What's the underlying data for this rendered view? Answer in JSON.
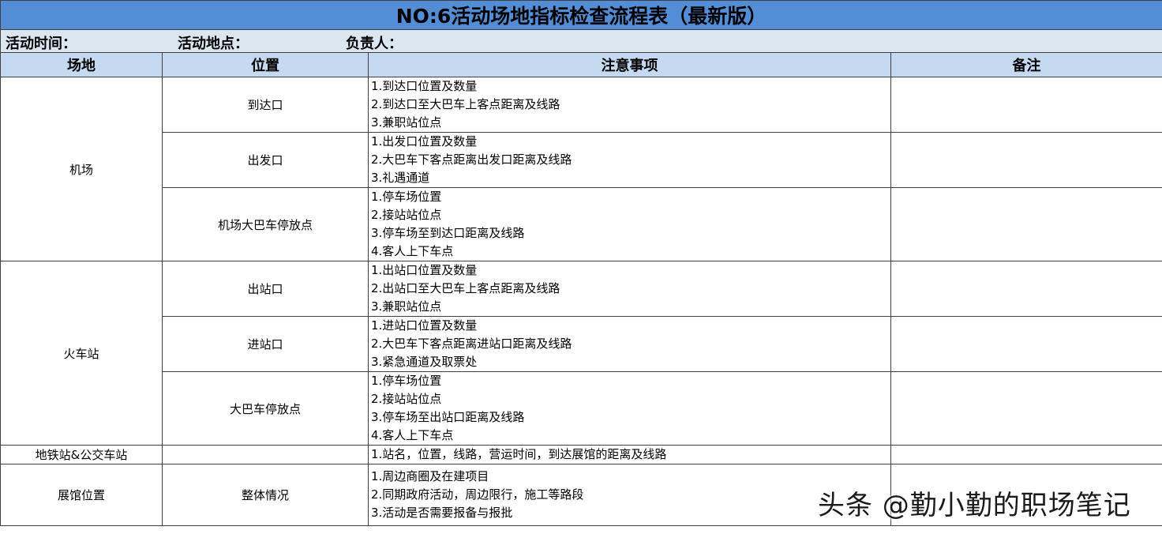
{
  "title": "NO:6活动场地指标检查流程表（最新版）",
  "meta": {
    "time_label": "活动时间：",
    "location_label": "活动地点：",
    "owner_label": "负责人："
  },
  "headers": [
    "场地",
    "位置",
    "注意事项",
    "备注"
  ],
  "venues": [
    {
      "name": "机场",
      "positions": [
        {
          "name": "到达口",
          "notes": [
            "1.到达口位置及数量",
            "2.到达口至大巴车上客点距离及线路",
            "3.兼职站位点"
          ]
        },
        {
          "name": "出发口",
          "notes": [
            "1.出发口位置及数量",
            "2.大巴车下客点距离出发口距离及线路",
            "3.礼遇通道"
          ]
        },
        {
          "name": "机场大巴车停放点",
          "notes": [
            "1.停车场位置",
            "2.接站站位点",
            "3.停车场至到达口距离及线路",
            "4.客人上下车点"
          ]
        }
      ]
    },
    {
      "name": "火车站",
      "positions": [
        {
          "name": "出站口",
          "notes": [
            "1.出站口位置及数量",
            "2.出站口至大巴车上客点距离及线路",
            "3.兼职站位点"
          ]
        },
        {
          "name": "进站口",
          "notes": [
            "1.进站口位置及数量",
            "2.大巴车下客点距离进站口距离及线路",
            "3.紧急通道及取票处"
          ]
        },
        {
          "name": "大巴车停放点",
          "notes": [
            "1.停车场位置",
            "2.接站站位点",
            "3.停车场至出站口距离及线路",
            "4.客人上下车点"
          ]
        }
      ]
    },
    {
      "name": "地铁站&公交车站",
      "positions": [
        {
          "name": "",
          "notes": [
            "1.站名，位置，线路，营运时间，到达展馆的距离及线路"
          ]
        }
      ]
    },
    {
      "name": "展馆位置",
      "positions": [
        {
          "name": "整体情况",
          "notes": [
            "1.周边商圈及在建项目",
            "2.同期政府活动，周边限行，施工等路段",
            "3.活动是否需要报备与报批"
          ]
        }
      ]
    }
  ],
  "watermark": "头条 @勤小勤的职场笔记"
}
